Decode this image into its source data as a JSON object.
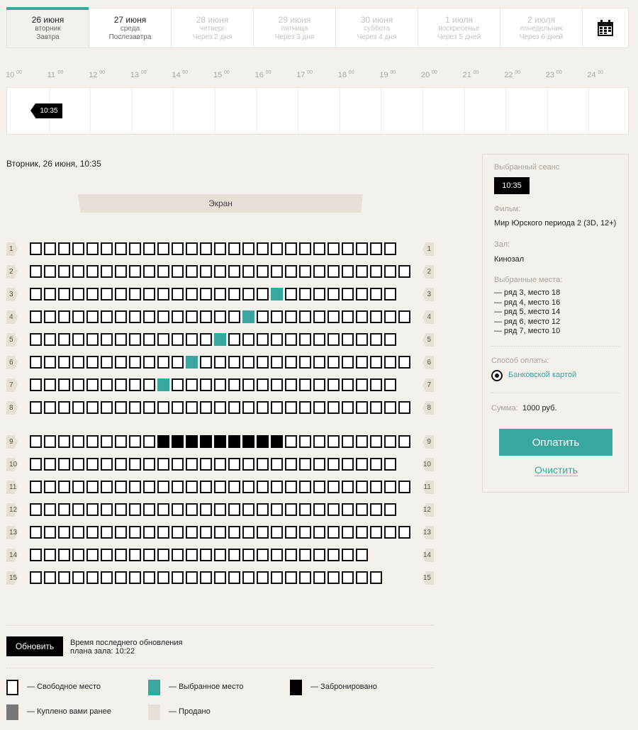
{
  "dates": [
    {
      "date": "26 июня",
      "weekday": "вторник",
      "relative": "Завтра",
      "state": "active"
    },
    {
      "date": "27 июня",
      "weekday": "среда",
      "relative": "Послезавтра",
      "state": "near"
    },
    {
      "date": "28 июня",
      "weekday": "четверг",
      "relative": "Через 2 дня",
      "state": "future"
    },
    {
      "date": "29 июня",
      "weekday": "пятница",
      "relative": "Через 3 дня",
      "state": "future"
    },
    {
      "date": "30 июня",
      "weekday": "суббота",
      "relative": "Через 4 дня",
      "state": "future"
    },
    {
      "date": "1 июля",
      "weekday": "воскресенье",
      "relative": "Через 5 дней",
      "state": "future"
    },
    {
      "date": "2 июля",
      "weekday": "понедельник",
      "relative": "Через 6 дней",
      "state": "future"
    }
  ],
  "calendar_icon": "calendar-icon",
  "timeline": {
    "hours": [
      "10",
      "11",
      "12",
      "13",
      "14",
      "15",
      "16",
      "17",
      "18",
      "19",
      "20",
      "21",
      "22",
      "23",
      "24"
    ],
    "minutes": "00",
    "session": "10:35"
  },
  "hall": {
    "session_date": "Вторник, 26 июня, 10:35",
    "screen_label": "Экран",
    "rows": [
      {
        "num": "1",
        "seats": 26,
        "selected": [],
        "reserved": []
      },
      {
        "num": "2",
        "seats": 27,
        "selected": [],
        "reserved": []
      },
      {
        "num": "3",
        "seats": 26,
        "selected": [
          18
        ],
        "reserved": []
      },
      {
        "num": "4",
        "seats": 27,
        "selected": [
          16
        ],
        "reserved": []
      },
      {
        "num": "5",
        "seats": 26,
        "selected": [
          14
        ],
        "reserved": []
      },
      {
        "num": "6",
        "seats": 27,
        "selected": [
          12
        ],
        "reserved": []
      },
      {
        "num": "7",
        "seats": 26,
        "selected": [
          10
        ],
        "reserved": []
      },
      {
        "num": "8",
        "seats": 27,
        "selected": [],
        "reserved": []
      },
      {
        "num": "9",
        "seats": 27,
        "selected": [],
        "reserved": [
          10,
          11,
          12,
          13,
          14,
          15,
          16,
          17,
          18
        ]
      },
      {
        "num": "10",
        "seats": 26,
        "selected": [],
        "reserved": []
      },
      {
        "num": "11",
        "seats": 27,
        "selected": [],
        "reserved": []
      },
      {
        "num": "12",
        "seats": 26,
        "selected": [],
        "reserved": []
      },
      {
        "num": "13",
        "seats": 27,
        "selected": [],
        "reserved": []
      },
      {
        "num": "14",
        "seats": 24,
        "selected": [],
        "reserved": []
      },
      {
        "num": "15",
        "seats": 25,
        "selected": [],
        "reserved": []
      }
    ]
  },
  "refresh": {
    "button_label": "Обновить",
    "update_text": "Время последнего обновления плана зала: 10:22"
  },
  "legend": {
    "free": "— Свободное место",
    "selected": "— Выбранное место",
    "reserved": "— Забронировано",
    "bought": "— Куплено вами ранее",
    "sold": "— Продано"
  },
  "panel": {
    "session_label": "Выбранный сеанс",
    "session_time": "10:35",
    "film_label": "Фильм:",
    "film_value": "Мир Юрского периода 2 (3D, 12+)",
    "hall_label": "Зал:",
    "hall_value": "Кинозал",
    "seats_label": "Выбранные места:",
    "seats": [
      "— ряд 3, место 18",
      "— ряд 4, место 16",
      "— ряд 5, место 14",
      "— ряд 6, место 12",
      "— ряд 7, место 10"
    ],
    "payment_label": "Способ оплаты:",
    "payment_method": "Банковской картой",
    "sum_label": "Сумма:",
    "sum_value": "1000 руб.",
    "pay_button": "Оплатить",
    "clear_link": "Очистить"
  },
  "colors": {
    "accent": "#3aa6a0",
    "reserved": "#000000",
    "bought": "#777777",
    "sold": "#e6e0d6",
    "free": "#ffffff"
  }
}
